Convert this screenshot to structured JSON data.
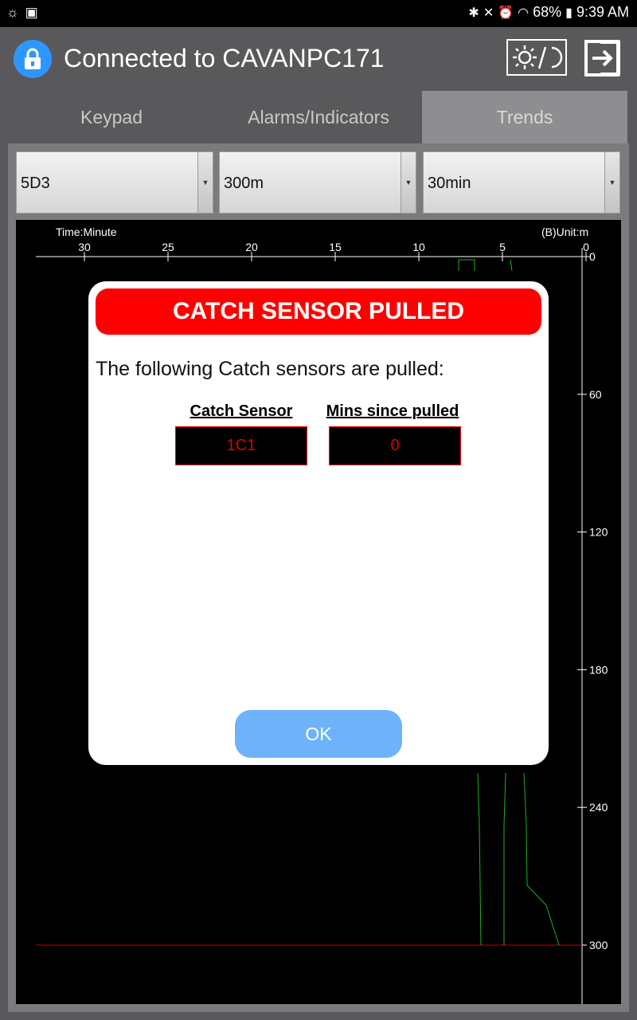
{
  "status_bar": {
    "battery": "68%",
    "time": "9:39 AM"
  },
  "app_bar": {
    "title": "Connected to CAVANPC171",
    "icons": [
      "lock-icon",
      "theme-toggle-icon",
      "exit-icon"
    ]
  },
  "tabs": [
    {
      "label": "Keypad",
      "active": false
    },
    {
      "label": "Alarms/Indicators",
      "active": false
    },
    {
      "label": "Trends",
      "active": true
    }
  ],
  "selectors": {
    "sensor": "5D3",
    "range": "300m",
    "window": "30min"
  },
  "chart": {
    "x_label": "Time:Minute",
    "y_label": "(B)Unit:m",
    "x_ticks": [
      "30",
      "25",
      "20",
      "15",
      "10",
      "5",
      "0"
    ],
    "y_ticks": [
      "0",
      "60",
      "120",
      "180",
      "240",
      "300"
    ]
  },
  "dialog": {
    "title": "CATCH SENSOR PULLED",
    "message": "The following Catch sensors are pulled:",
    "columns": [
      "Catch Sensor",
      "Mins since pulled"
    ],
    "rows": [
      {
        "sensor": "1C1",
        "mins": "0"
      }
    ],
    "ok_label": "OK"
  },
  "colors": {
    "accent_blue": "#2e97ff",
    "alarm_red": "#ff0000",
    "ok_button": "#6eb2fa",
    "trace_green": "#1fae2a"
  }
}
